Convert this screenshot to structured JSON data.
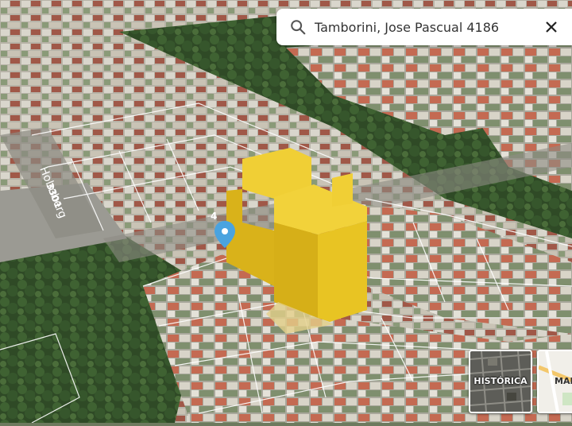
{
  "search": {
    "query": "Tamborini, Jose Pascual 4186",
    "search_icon": "search-icon",
    "clear_icon": "close-icon"
  },
  "map": {
    "street_labels": [
      {
        "text": "Holmberg"
      },
      {
        "text": "3301"
      },
      {
        "text": "4"
      }
    ],
    "marker_icon": "location-pin-icon",
    "marker_color": "#4aa3df",
    "building_color": "#e6c21d"
  },
  "layers": [
    {
      "label": "HISTÓRICA",
      "icon": "historic-layer-icon"
    },
    {
      "label": "MAPA",
      "icon": "map-layer-icon"
    }
  ]
}
